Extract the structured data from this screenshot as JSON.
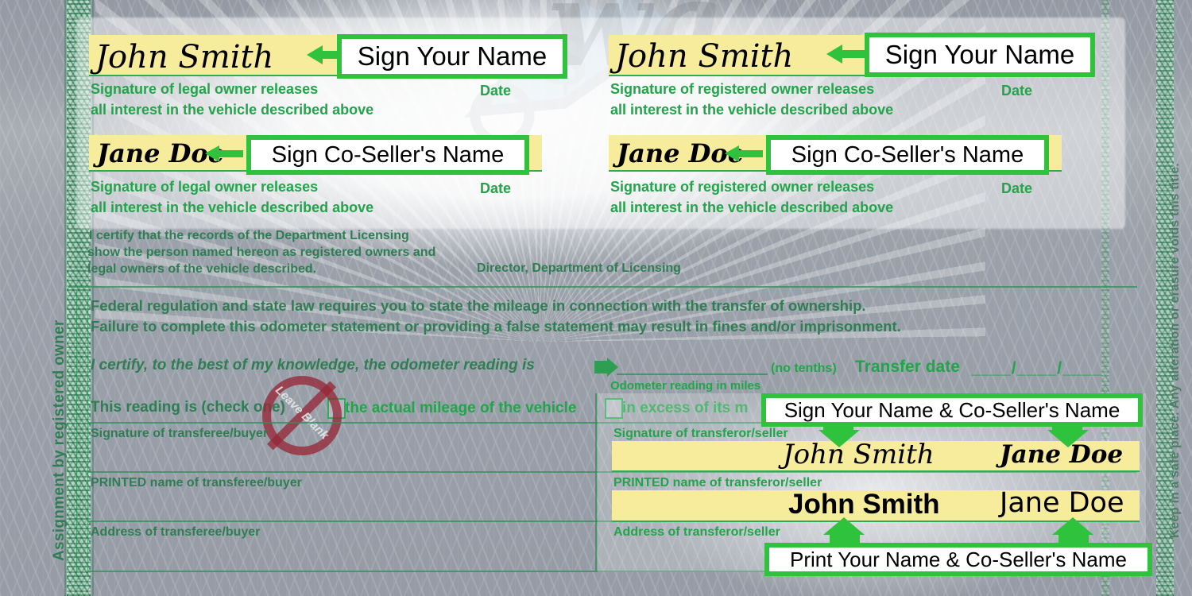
{
  "document": {
    "type": "vehicle-title-certificate",
    "side_label_left": "Assignment by registered owner",
    "side_label_right": "Keep in a safe place.   Any alteration or erasure voids this title.",
    "watermark_script": "wa"
  },
  "colors": {
    "accent_green": "#2fc23c",
    "form_green": "#22a44a",
    "dark_green": "#2f7d52",
    "highlight_yellow": "#f7eb9c",
    "stamp_red": "#962837",
    "paper_gray": "#9aa0a9"
  },
  "release_section": {
    "legal_owner": {
      "signature_value": "John Smith",
      "caption_line1": "Signature of legal owner releases",
      "caption_line2": "all interest in the vehicle described above",
      "date_label": "Date",
      "co_signature_value": "Jane Doe",
      "co_caption_line1": "Signature of legal owner releases",
      "co_caption_line2": "all interest in the vehicle described above",
      "co_date_label": "Date"
    },
    "registered_owner": {
      "signature_value": "John Smith",
      "caption_line1": "Signature of registered owner releases",
      "caption_line2": "all interest in the vehicle described above",
      "date_label": "Date",
      "co_signature_value": "Jane Doe",
      "co_caption_line1": "Signature of registered owner releases",
      "co_caption_line2": "all interest in the vehicle described above",
      "co_date_label": "Date"
    }
  },
  "certification": {
    "line1": "I certify that the records of the Department Licensing",
    "line2": "show the person named hereon as registered owners and",
    "line3": "legal owners of the vehicle described.",
    "director_label": "Director, Department of Licensing"
  },
  "odometer": {
    "federal_line1": "Federal regulation and state law requires you to state the mileage in connection with the transfer of ownership.",
    "federal_line2": "Failure to complete this odometer statement or providing a false statement may result in fines and/or imprisonment.",
    "certify_text": "I certify, to the best of my knowledge, the odometer reading is",
    "no_tenths": "(no tenths)",
    "reading_caption": "Odometer reading in miles",
    "reading_value": "",
    "transfer_date_label": "Transfer date",
    "transfer_date_value": "____/____/____",
    "check_one_text": "This reading is (check one)",
    "option_actual": "the actual mileage of the vehicle",
    "option_excess": "in excess of its m"
  },
  "transfer_fields": {
    "buyer": {
      "signature_caption": "Signature of transferee/buyer",
      "signature_value": "",
      "printed_caption": "PRINTED name of transferee/buyer",
      "printed_value": "",
      "address_caption": "Address of transferee/buyer",
      "address_value": ""
    },
    "seller": {
      "signature_caption": "Signature of transferor/seller",
      "signature_value": "John Smith",
      "co_signature_value": "Jane Doe",
      "printed_caption": "PRINTED name of transferor/seller",
      "printed_value": "John Smith",
      "co_printed_value": "Jane Doe",
      "address_caption": "Address of transferor/seller",
      "address_value": ""
    }
  },
  "callouts": {
    "sign_name_left": "Sign Your Name",
    "sign_name_right": "Sign Your Name",
    "sign_coseller_left": "Sign Co-Seller's Name",
    "sign_coseller_right": "Sign Co-Seller's Name",
    "sign_both": "Sign Your Name & Co-Seller's Name",
    "print_both": "Print Your Name & Co-Seller's Name",
    "leave_blank_stamp": "Leave Blank"
  }
}
